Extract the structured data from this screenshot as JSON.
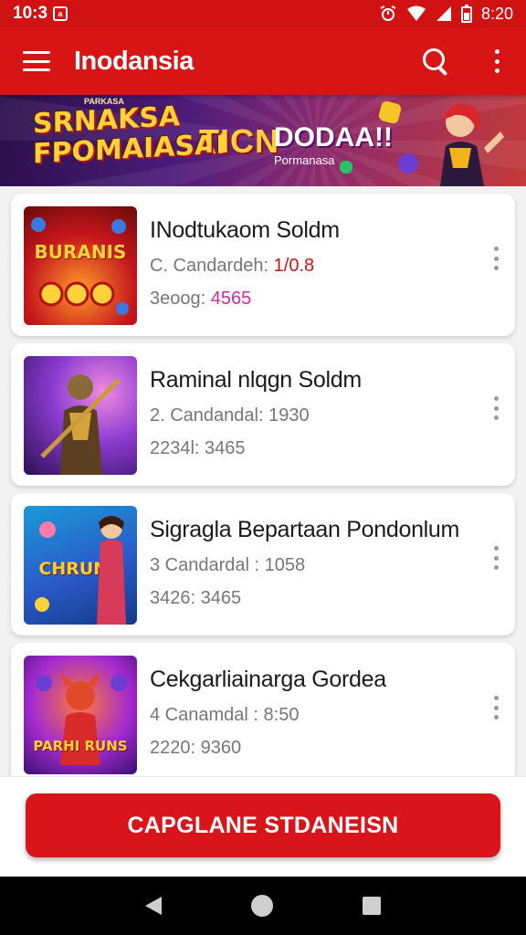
{
  "status_bar": {
    "time": "10:3",
    "notification_icon": "notification-square-icon",
    "right_time": "8:20"
  },
  "app_bar": {
    "title": "Inodansia",
    "icons": [
      "menu-icon",
      "search-icon",
      "more-vert-icon"
    ]
  },
  "banner": {
    "small_text": "PARKASA",
    "title_line1": "SRNAKSA",
    "title_line2": "FPOMAIASAI",
    "mid_text": "TICN",
    "right_text": "DODAA!!",
    "right_sub": "Pormanasa"
  },
  "games": [
    {
      "title": "INodtukaom Soldm",
      "line2_prefix": "C. Candardeh: ",
      "line2_accent": "1/0.8",
      "line3_prefix": "3eoog: ",
      "line3_accent": "4565",
      "thumb_text": "BURANIS",
      "colors": [
        "#c4161c",
        "#ff7a1a"
      ]
    },
    {
      "title": "Raminal nlqgn Soldm",
      "line2_prefix": "2. Candandal: 1930",
      "line2_accent": "",
      "line3_prefix": "2234l: 3465",
      "line3_accent": "",
      "thumb_text": "",
      "colors": [
        "#3b1c6e",
        "#c24fd4"
      ]
    },
    {
      "title": "Sigragla Bepartaan Pondonlum",
      "line2_prefix": "3 Candardal : 1058",
      "line2_accent": "",
      "line3_prefix": "3426: 3465",
      "line3_accent": "",
      "thumb_text": "CHRUNU",
      "colors": [
        "#1a7bd6",
        "#f0a020"
      ]
    },
    {
      "title": "Cekgarliainarga Gordea",
      "line2_prefix": "4 Canamdal : 8:50",
      "line2_accent": "",
      "line3_prefix": "2220: 9360",
      "line3_accent": "",
      "thumb_text": "PARHI RUNS",
      "colors": [
        "#6a1a9a",
        "#ff5a2a"
      ]
    }
  ],
  "cta": {
    "label": "CAPGLANE STDANEISN"
  },
  "nav_bar": {
    "icons": [
      "back-icon",
      "home-icon",
      "recents-icon"
    ]
  },
  "theme": {
    "primary": "#d91414",
    "status_bar": "#d11212"
  }
}
